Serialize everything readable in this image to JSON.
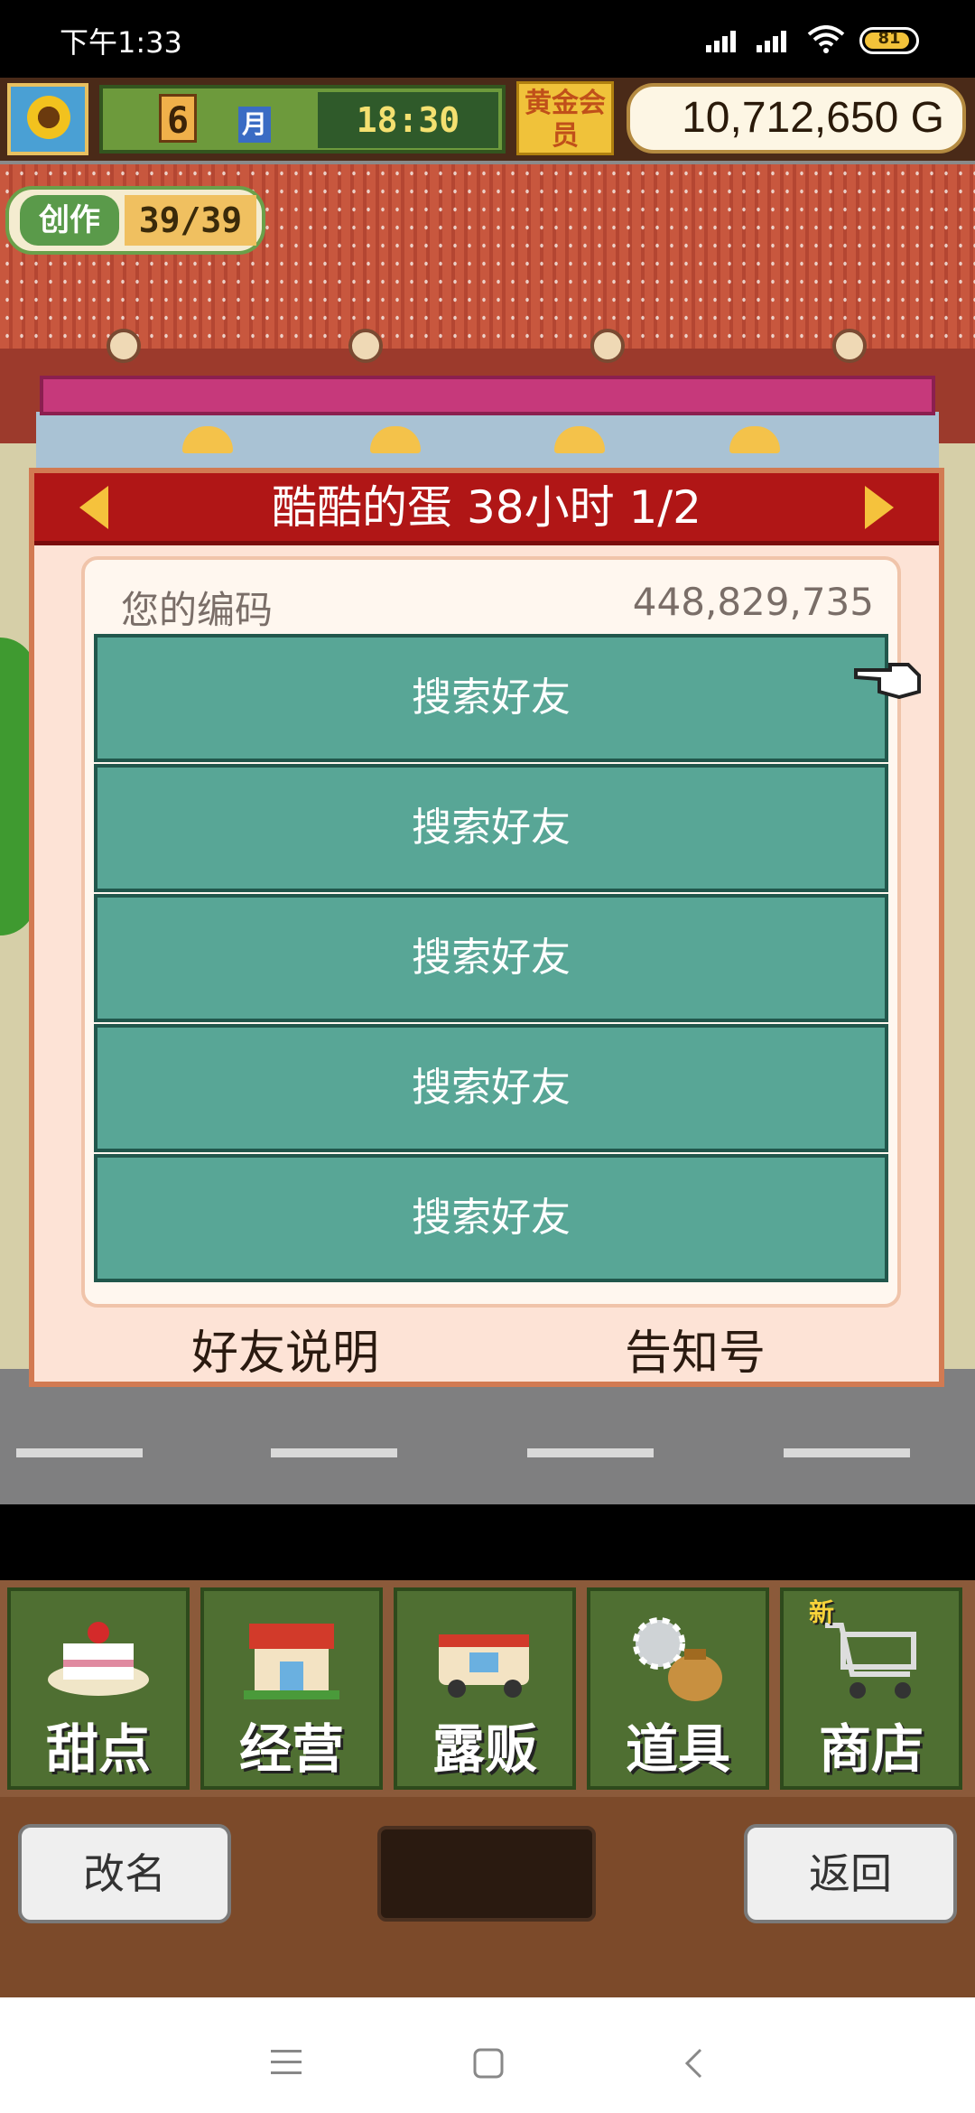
{
  "status_bar": {
    "time": "下午1:33",
    "battery_percent": "81",
    "icons": [
      "cell-signal-icon",
      "cell-signal-icon",
      "wifi-icon",
      "battery-icon"
    ]
  },
  "hud": {
    "month": "6",
    "month_label": "月",
    "clock": "18:30",
    "member_badge": "黄金会员",
    "money": "10,712,650 G",
    "create_label": "创作",
    "create_value": "39/39"
  },
  "dialog": {
    "title": "酷酷的蛋  38小时 1/2",
    "your_code_label": "您的编码",
    "your_code_value": "448,829,735",
    "friend_slots": [
      {
        "label": "搜索好友"
      },
      {
        "label": "搜索好友"
      },
      {
        "label": "搜索好友"
      },
      {
        "label": "搜索好友"
      },
      {
        "label": "搜索好友"
      }
    ],
    "help_label": "好友说明",
    "notice_label": "告知号"
  },
  "menu": {
    "items": [
      {
        "label": "甜点",
        "icon": "cake-icon"
      },
      {
        "label": "经营",
        "icon": "shop-icon"
      },
      {
        "label": "露贩",
        "icon": "food-truck-icon"
      },
      {
        "label": "道具",
        "icon": "gear-bag-icon"
      },
      {
        "label": "商店",
        "icon": "shopping-cart-icon",
        "badge": "新"
      }
    ]
  },
  "bottom": {
    "rename_label": "改名",
    "back_label": "返回"
  },
  "navbar": {
    "icons": [
      "menu-icon",
      "home-icon",
      "back-icon"
    ]
  },
  "colors": {
    "dialog_header": "#b01616",
    "friend_button": "#58a696",
    "dialog_bg": "#fde3d6"
  }
}
